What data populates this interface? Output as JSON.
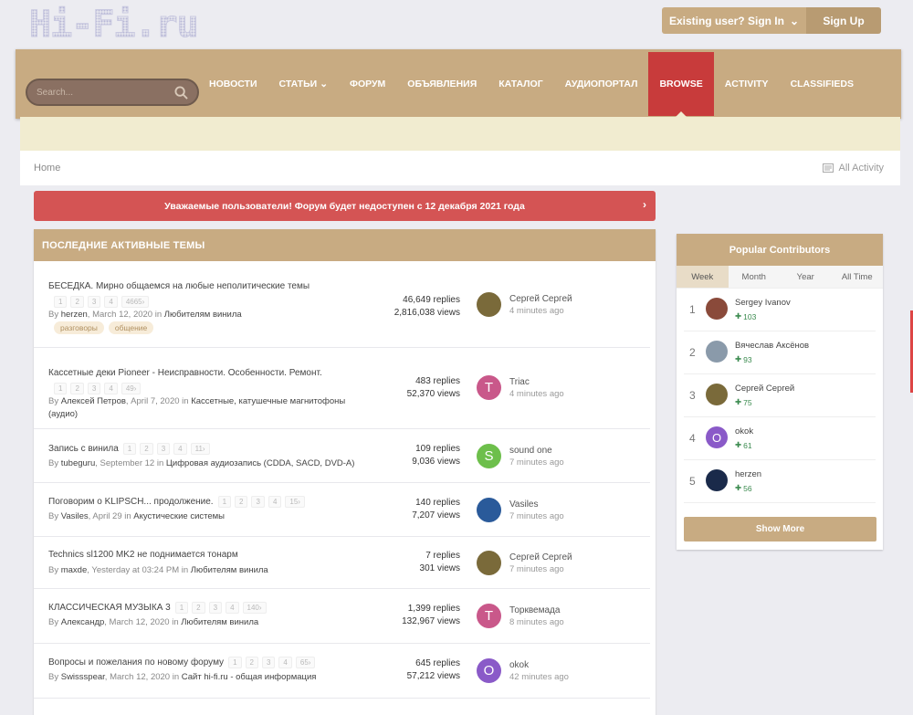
{
  "logo": "Hi-Fi.ru",
  "auth": {
    "signin": "Existing user? Sign In",
    "signup": "Sign Up"
  },
  "search": {
    "placeholder": "Search..."
  },
  "nav": [
    "НОВОСТИ",
    "СТАТЬИ",
    "ФОРУМ",
    "ОБЪЯВЛЕНИЯ",
    "КАТАЛОГ",
    "АУДИОПОРТАЛ",
    "BROWSE",
    "ACTIVITY",
    "CLASSIFIEDS"
  ],
  "breadcrumb": {
    "home": "Home",
    "all_activity": "All Activity"
  },
  "alert": "Уважаемые пользователи! Форум будет недоступен с 12 декабря 2021 года",
  "topics_title": "ПОСЛЕДНИЕ АКТИВНЫЕ ТЕМЫ",
  "topics": [
    {
      "title": "БЕСЕДКА. Мирно общаемся на любые неполитические темы",
      "pages": [
        "1",
        "2",
        "3",
        "4",
        "4665›"
      ],
      "by": "By",
      "author": "herzen",
      "date": ", March 12, 2020 in",
      "forum": "Любителям винила",
      "tags": [
        "разговоры",
        "общение"
      ],
      "replies": "46,649 replies",
      "views": "2,816,038 views",
      "last_user": "Сергей Сергей",
      "last_time": "4 minutes ago",
      "avatar": "photo",
      "avatar_color": "#7a6a3a",
      "letter": ""
    },
    {
      "title": "Кассетные деки Pioneer - Неисправности. Особенности. Ремонт.",
      "pages": [
        "1",
        "2",
        "3",
        "4",
        "49›"
      ],
      "by": "By",
      "author": "Алексей Петров",
      "date": ", April 7, 2020 in",
      "forum": "Кассетные, катушечные магнитофоны",
      "forum2": "(аудио)",
      "replies": "483 replies",
      "views": "52,370 views",
      "last_user": "Triac",
      "last_time": "4 minutes ago",
      "avatar": "letter",
      "avatar_color": "#c9588a",
      "letter": "T"
    },
    {
      "title": "Запись с винила",
      "pages": [
        "1",
        "2",
        "3",
        "4",
        "11›"
      ],
      "by": "By",
      "author": "tubeguru",
      "date": ", September 12 in",
      "forum": "Цифровая аудиозапись (CDDA, SACD, DVD-A)",
      "replies": "109 replies",
      "views": "9,036 views",
      "last_user": "sound one",
      "last_time": "7 minutes ago",
      "avatar": "letter",
      "avatar_color": "#6dbf4b",
      "letter": "S"
    },
    {
      "title": "Поговорим о KLIPSCH... продолжение.",
      "pages": [
        "1",
        "2",
        "3",
        "4",
        "15›"
      ],
      "by": "By",
      "author": "Vasiles",
      "date": ", April 29 in",
      "forum": "Акустические системы",
      "replies": "140 replies",
      "views": "7,207 views",
      "last_user": "Vasiles",
      "last_time": "7 minutes ago",
      "avatar": "photo",
      "avatar_color": "#2a5a9a",
      "letter": ""
    },
    {
      "title": "Technics sl1200 MK2 не поднимается тонарм",
      "pages": [],
      "by": "By",
      "author": "maxde",
      "date": ", Yesterday at 03:24 PM in",
      "forum": "Любителям винила",
      "replies": "7 replies",
      "views": "301 views",
      "last_user": "Сергей Сергей",
      "last_time": "7 minutes ago",
      "avatar": "photo",
      "avatar_color": "#7a6a3a",
      "letter": ""
    },
    {
      "title": "КЛАССИЧЕСКАЯ МУЗЫКА 3",
      "pages": [
        "1",
        "2",
        "3",
        "4",
        "140›"
      ],
      "by": "By",
      "author": "Александр",
      "date": ", March 12, 2020 in",
      "forum": "Любителям винила",
      "replies": "1,399 replies",
      "views": "132,967 views",
      "last_user": "Торквемада",
      "last_time": "8 minutes ago",
      "avatar": "letter",
      "avatar_color": "#c9588a",
      "letter": "T"
    },
    {
      "title": "Вопросы и пожелания по новому форуму",
      "pages": [
        "1",
        "2",
        "3",
        "4",
        "65›"
      ],
      "by": "By",
      "author": "Swissspear",
      "date": ", March 12, 2020 in",
      "forum": "Сайт hi-fi.ru - общая информация",
      "replies": "645 replies",
      "views": "57,212 views",
      "last_user": "okok",
      "last_time": "42 minutes ago",
      "avatar": "letter",
      "avatar_color": "#8a5ac8",
      "letter": "O"
    }
  ],
  "contributors": {
    "title": "Popular Contributors",
    "tabs": [
      "Week",
      "Month",
      "Year",
      "All Time"
    ],
    "items": [
      {
        "rank": "1",
        "name": "Sergey Ivanov",
        "rep": "103",
        "color": "#8a4a3a",
        "letter": ""
      },
      {
        "rank": "2",
        "name": "Вячеслав Аксёнов",
        "rep": "93",
        "color": "#8a9aaa",
        "letter": ""
      },
      {
        "rank": "3",
        "name": "Сергей Сергей",
        "rep": "75",
        "color": "#7a6a3a",
        "letter": ""
      },
      {
        "rank": "4",
        "name": "okok",
        "rep": "61",
        "color": "#8a5ac8",
        "letter": "O"
      },
      {
        "rank": "5",
        "name": "herzen",
        "rep": "56",
        "color": "#1a2a4a",
        "letter": ""
      }
    ],
    "show_more": "Show More"
  }
}
